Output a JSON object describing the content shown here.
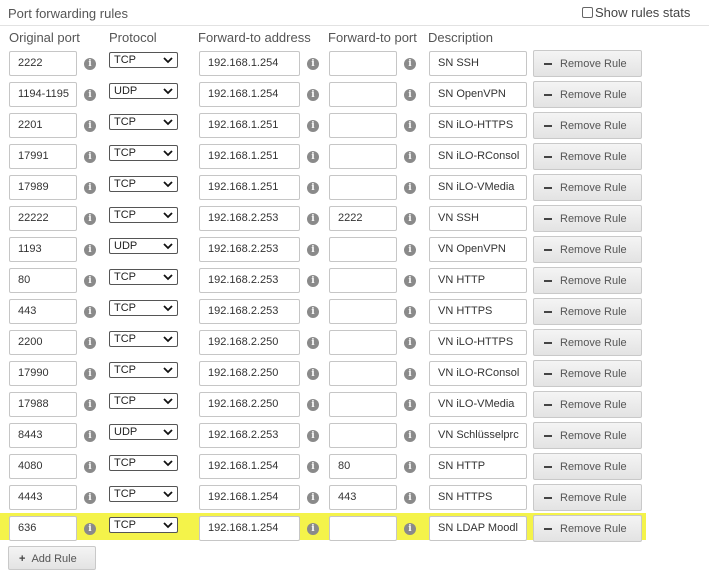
{
  "header": {
    "title": "Port forwarding rules",
    "stats_label": "Show rules stats"
  },
  "columns": {
    "original_port": "Original port",
    "protocol": "Protocol",
    "forward_address": "Forward-to address",
    "forward_port": "Forward-to port",
    "description": "Description"
  },
  "rows": [
    {
      "port": "2222",
      "protocol": "TCP",
      "address": "192.168.1.254",
      "fwd_port": "",
      "description": "SN SSH"
    },
    {
      "port": "1194-1195",
      "protocol": "UDP",
      "address": "192.168.1.254",
      "fwd_port": "",
      "description": "SN OpenVPN"
    },
    {
      "port": "2201",
      "protocol": "TCP",
      "address": "192.168.1.251",
      "fwd_port": "",
      "description": "SN iLO-HTTPS"
    },
    {
      "port": "17991",
      "protocol": "TCP",
      "address": "192.168.1.251",
      "fwd_port": "",
      "description": "SN iLO-RConsol"
    },
    {
      "port": "17989",
      "protocol": "TCP",
      "address": "192.168.1.251",
      "fwd_port": "",
      "description": "SN iLO-VMedia"
    },
    {
      "port": "22222",
      "protocol": "TCP",
      "address": "192.168.2.253",
      "fwd_port": "2222",
      "description": "VN SSH"
    },
    {
      "port": "1193",
      "protocol": "UDP",
      "address": "192.168.2.253",
      "fwd_port": "",
      "description": "VN OpenVPN"
    },
    {
      "port": "80",
      "protocol": "TCP",
      "address": "192.168.2.253",
      "fwd_port": "",
      "description": "VN HTTP"
    },
    {
      "port": "443",
      "protocol": "TCP",
      "address": "192.168.2.253",
      "fwd_port": "",
      "description": "VN HTTPS"
    },
    {
      "port": "2200",
      "protocol": "TCP",
      "address": "192.168.2.250",
      "fwd_port": "",
      "description": "VN iLO-HTTPS"
    },
    {
      "port": "17990",
      "protocol": "TCP",
      "address": "192.168.2.250",
      "fwd_port": "",
      "description": "VN iLO-RConsol"
    },
    {
      "port": "17988",
      "protocol": "TCP",
      "address": "192.168.2.250",
      "fwd_port": "",
      "description": "VN iLO-VMedia"
    },
    {
      "port": "8443",
      "protocol": "UDP",
      "address": "192.168.2.253",
      "fwd_port": "",
      "description": "VN Schlüsselprc"
    },
    {
      "port": "4080",
      "protocol": "TCP",
      "address": "192.168.1.254",
      "fwd_port": "80",
      "description": "SN HTTP"
    },
    {
      "port": "4443",
      "protocol": "TCP",
      "address": "192.168.1.254",
      "fwd_port": "443",
      "description": "SN HTTPS"
    },
    {
      "port": "636",
      "protocol": "TCP",
      "address": "192.168.1.254",
      "fwd_port": "",
      "description": "SN LDAP Moodl",
      "highlighted": true
    }
  ],
  "remove_label": "Remove Rule",
  "add_label": "Add Rule",
  "info_glyph": "i",
  "colors": {
    "highlight": "#f4f34a",
    "button_bg": "#e9e9e9",
    "field_border": "#c6c6c6",
    "info_icon": "#8a8a8a"
  }
}
